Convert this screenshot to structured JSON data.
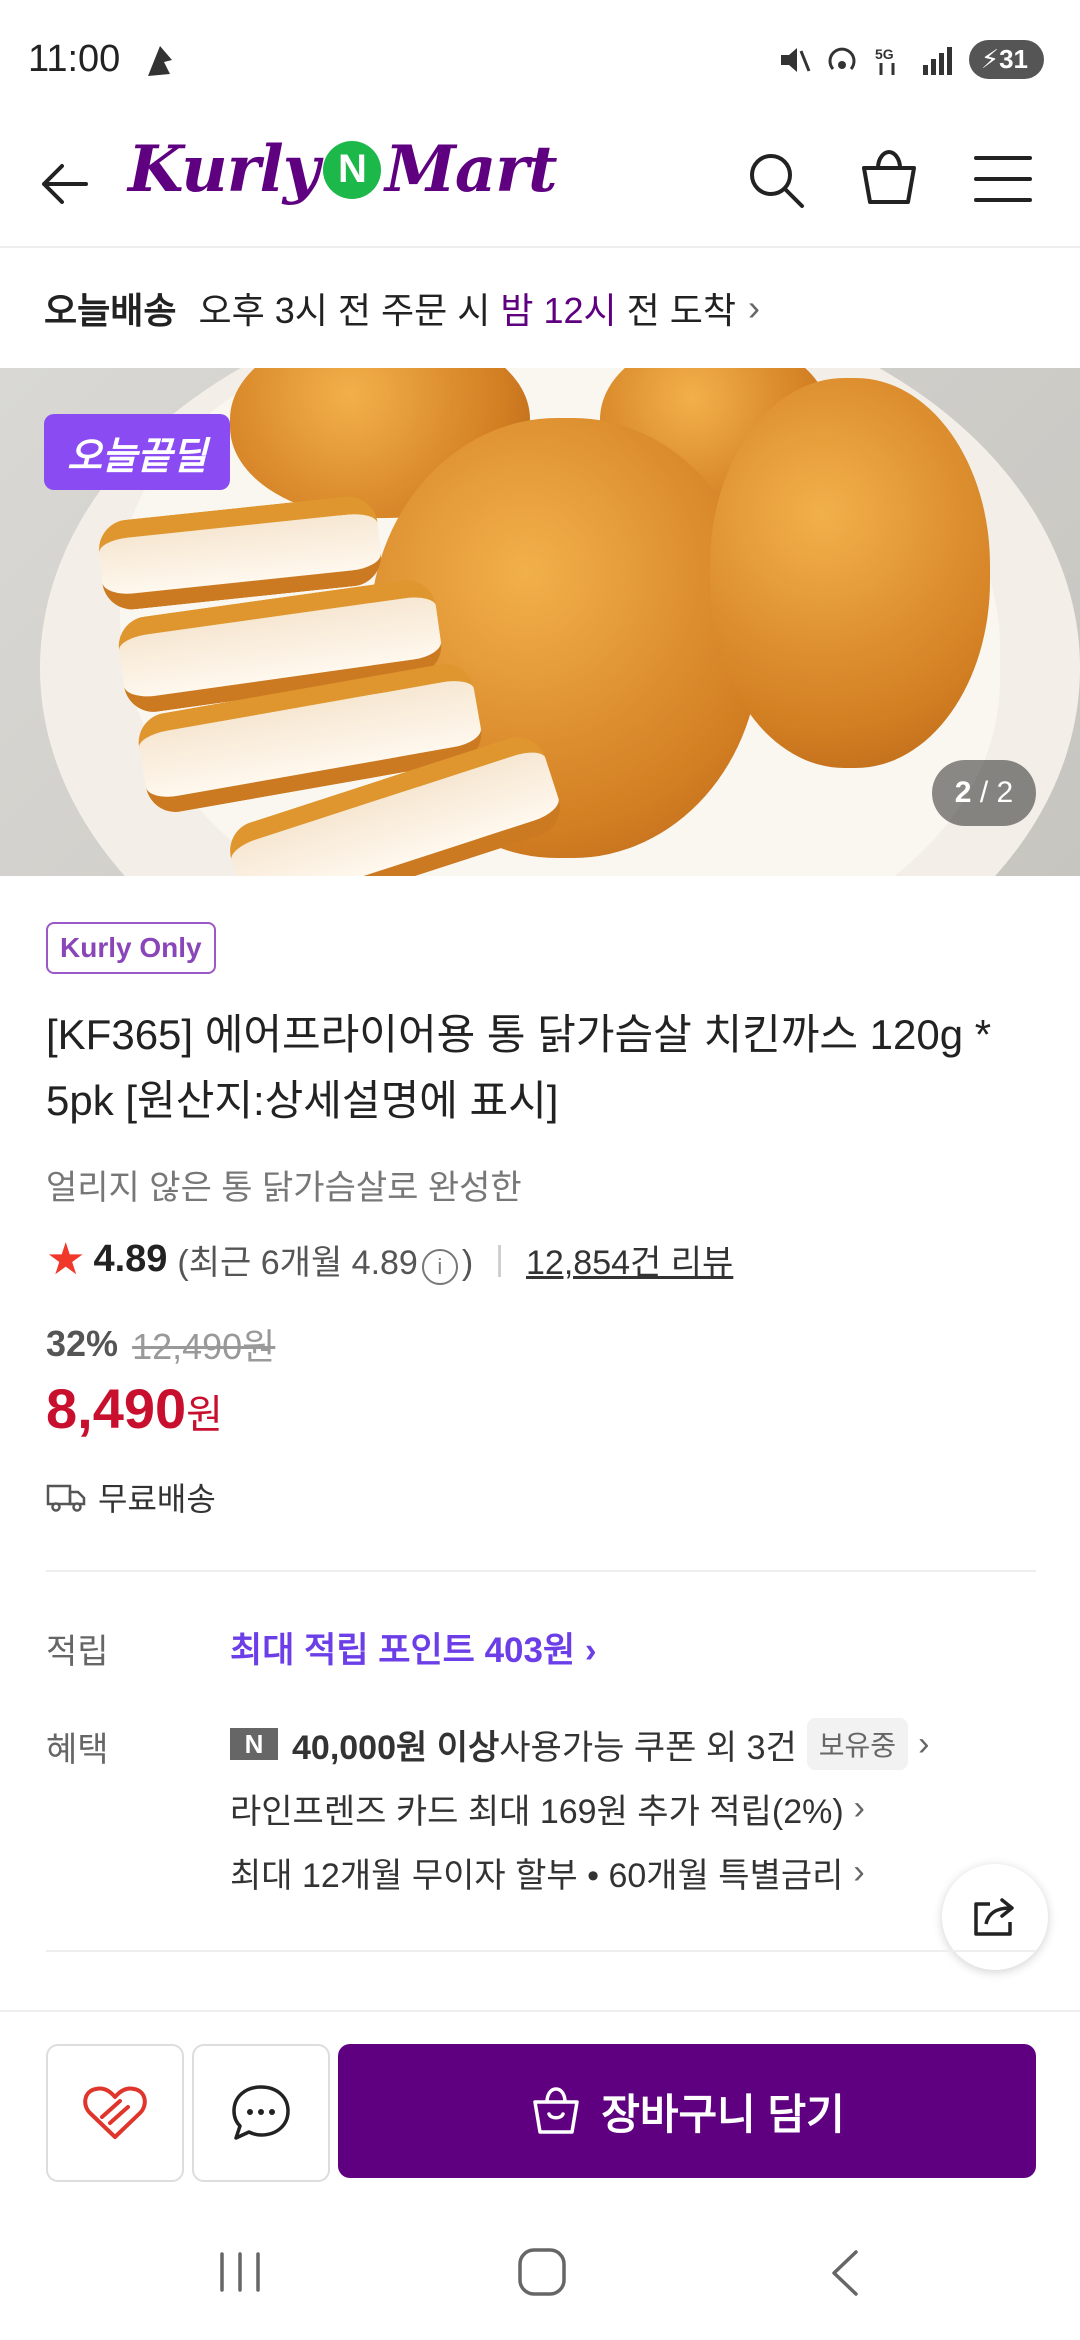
{
  "status_bar": {
    "time": "11:00",
    "battery": "31"
  },
  "header": {
    "logo_left": "Kurly",
    "logo_mid": "N",
    "logo_right": "Mart"
  },
  "delivery": {
    "label": "오늘배송",
    "text_before": "오후 3시 전 주문 시 ",
    "highlight": "밤 12시",
    "text_after": " 전 도착",
    "chevron": "›"
  },
  "hero": {
    "badge": "오늘끝딜",
    "counter_current": "2",
    "counter_total": "/ 2"
  },
  "product": {
    "tag": "Kurly Only",
    "title": "[KF365] 에어프라이어용 통 닭가슴살 치킨까스 120g * 5pk [원산지:상세설명에 표시]",
    "subtitle": "얼리지 않은 통 닭가슴살로 완성한",
    "rating": "4.89",
    "rating_recent": "(최근 6개월 4.89",
    "rating_close": ")",
    "reviews": "12,854건 리뷰",
    "discount_rate": "32%",
    "original_price": "12,490원",
    "price": "8,490",
    "price_unit": "원",
    "shipping": "무료배송"
  },
  "rewards": {
    "label": "적립",
    "points": "최대 적립 포인트 403원 ›"
  },
  "benefits": {
    "label": "혜택",
    "coupon_n": "N",
    "coupon_bold": "40,000원 이상",
    "coupon_text": " 사용가능 쿠폰 외 3건",
    "coupon_status": "보유중",
    "card": "라인프렌즈 카드 최대 169원 추가 적립(2%)",
    "installment": "최대 12개월 무이자 할부 • 60개월 특별금리",
    "chevron": "›"
  },
  "bottom_bar": {
    "cart_label": "장바구니 담기"
  },
  "colors": {
    "brand": "#5f0080",
    "price": "#c8102e",
    "points": "#6c3ee8",
    "badge": "#8a4cf2"
  }
}
